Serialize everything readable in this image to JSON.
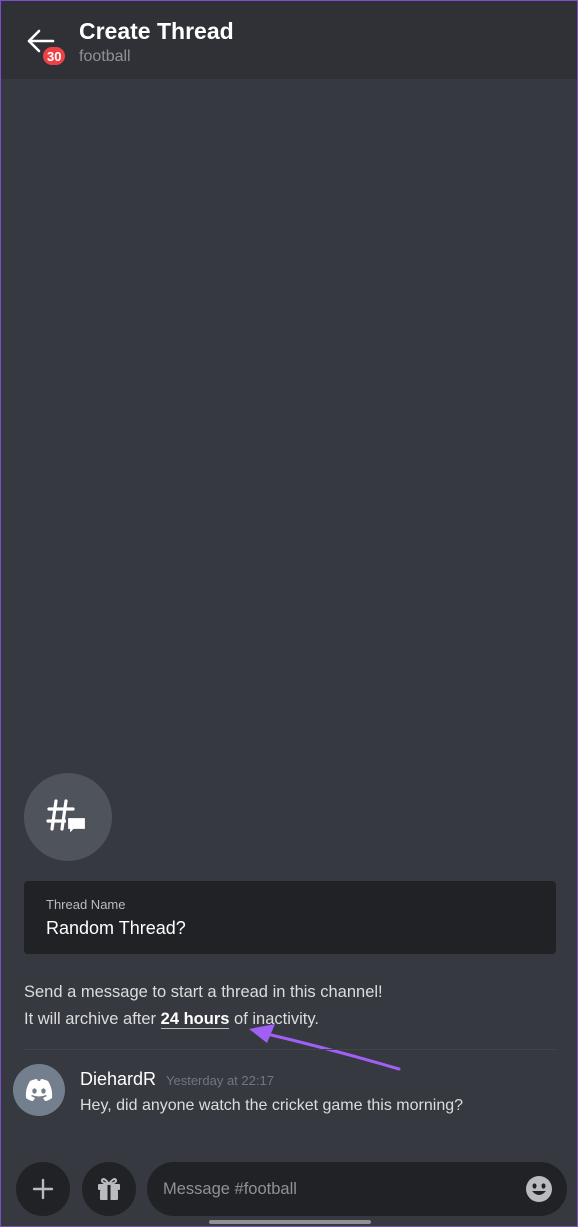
{
  "header": {
    "title": "Create Thread",
    "subtitle": "football",
    "notification_count": "30"
  },
  "thread_form": {
    "label": "Thread Name",
    "value": "Random Thread?"
  },
  "info": {
    "line1": "Send a message to start a thread in this channel!",
    "line2_prefix": "It will archive after",
    "line2_highlight": "24 hours",
    "line2_suffix": "of inactivity."
  },
  "message": {
    "author": "DiehardR",
    "timestamp": "Yesterday at 22:17",
    "text": "Hey, did anyone watch the cricket game this morning?"
  },
  "composer": {
    "placeholder": "Message #football"
  },
  "colors": {
    "background": "#36393f",
    "header": "#2f3136",
    "input": "#202225",
    "badge": "#ed4245",
    "annotation": "#a25ff5"
  }
}
